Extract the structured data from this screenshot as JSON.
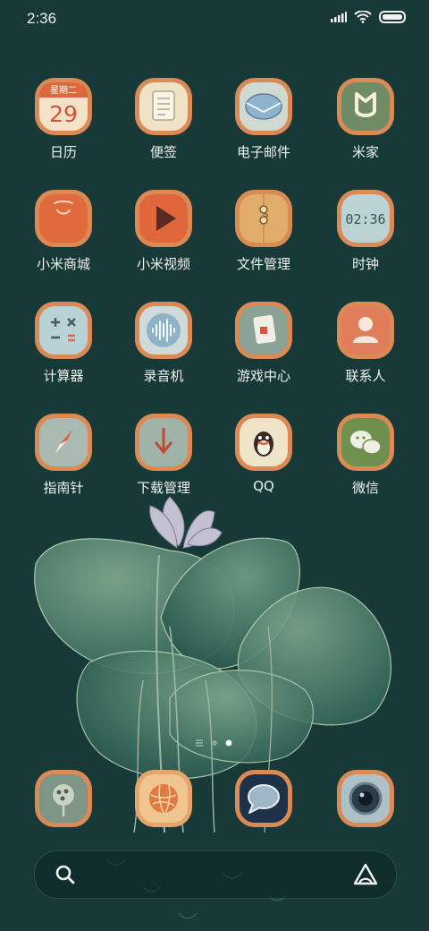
{
  "status_bar": {
    "time": "2:36",
    "icons": [
      "signal-icon",
      "wifi-icon",
      "battery-icon"
    ]
  },
  "calendar_icon": {
    "weekday": "星期二",
    "day": "29"
  },
  "clock_icon": {
    "time": "02:36"
  },
  "apps": [
    {
      "label": "日历",
      "icon": "calendar-icon"
    },
    {
      "label": "便签",
      "icon": "notes-icon"
    },
    {
      "label": "电子邮件",
      "icon": "email-icon"
    },
    {
      "label": "米家",
      "icon": "mijia-icon"
    },
    {
      "label": "小米商城",
      "icon": "shopping-bag-icon"
    },
    {
      "label": "小米视频",
      "icon": "video-play-icon"
    },
    {
      "label": "文件管理",
      "icon": "file-folder-icon"
    },
    {
      "label": "时钟",
      "icon": "clock-icon"
    },
    {
      "label": "计算器",
      "icon": "calculator-icon"
    },
    {
      "label": "录音机",
      "icon": "recorder-icon"
    },
    {
      "label": "游戏中心",
      "icon": "game-center-icon"
    },
    {
      "label": "联系人",
      "icon": "contacts-icon"
    },
    {
      "label": "指南针",
      "icon": "compass-icon"
    },
    {
      "label": "下载管理",
      "icon": "download-icon"
    },
    {
      "label": "QQ",
      "icon": "qq-icon"
    },
    {
      "label": "微信",
      "icon": "wechat-icon"
    }
  ],
  "dock": [
    {
      "icon": "phone-lotus-icon"
    },
    {
      "icon": "browser-icon"
    },
    {
      "icon": "messages-icon"
    },
    {
      "icon": "camera-icon"
    }
  ],
  "page_indicator": {
    "pages": 3,
    "current": 3
  },
  "search_bar": {
    "left_icon": "search-icon",
    "right_icon": "assistant-icon"
  },
  "colors": {
    "background": "#173a38",
    "icon_border": "#d9935a",
    "label": "#eef2ee"
  }
}
